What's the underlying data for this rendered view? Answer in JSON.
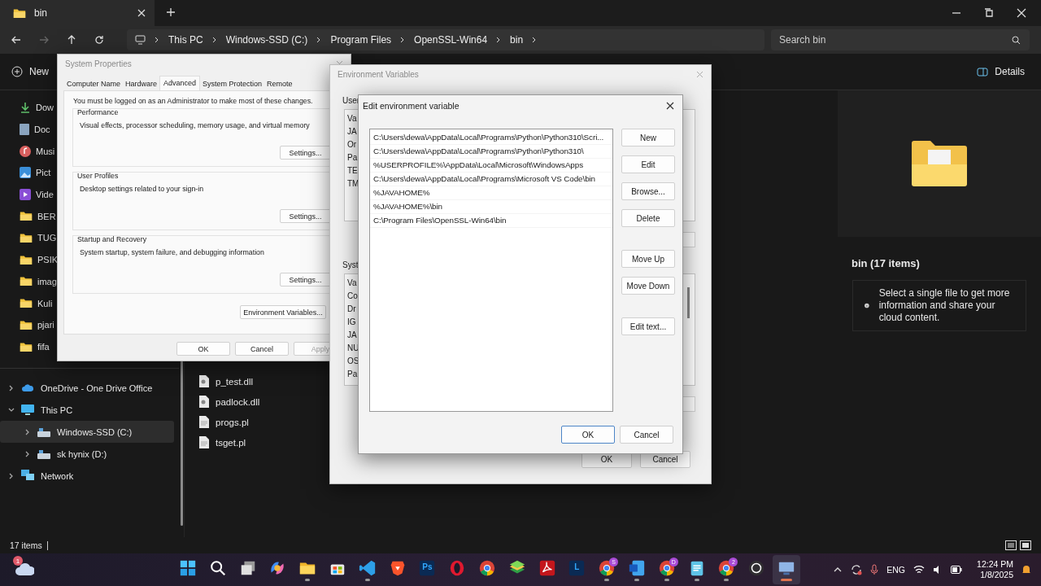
{
  "explorer": {
    "tab": {
      "title": "bin"
    },
    "breadcrumb": [
      "This PC",
      "Windows-SSD (C:)",
      "Program Files",
      "OpenSSL-Win64",
      "bin"
    ],
    "search": {
      "placeholder": "Search bin"
    },
    "toolbar": {
      "new": "New",
      "details": "Details"
    },
    "quick_access": [
      {
        "label": "Dow",
        "kind": "download"
      },
      {
        "label": "Doc",
        "kind": "document"
      },
      {
        "label": "Musi",
        "kind": "music"
      },
      {
        "label": "Pict",
        "kind": "picture"
      },
      {
        "label": "Vide",
        "kind": "video"
      },
      {
        "label": "BER",
        "kind": "folder"
      },
      {
        "label": "TUG",
        "kind": "folder"
      },
      {
        "label": "PSIK",
        "kind": "folder"
      },
      {
        "label": "imag",
        "kind": "folder"
      },
      {
        "label": "Kuli",
        "kind": "folder"
      },
      {
        "label": "pjari",
        "kind": "folder"
      },
      {
        "label": "fifa",
        "kind": "folder"
      }
    ],
    "tree": [
      {
        "label": "OneDrive - One Drive Office",
        "kind": "cloud",
        "expanded": false,
        "selected": false
      },
      {
        "label": "This PC",
        "kind": "pc",
        "expanded": true,
        "selected": false,
        "children": [
          {
            "label": "Windows-SSD (C:)",
            "kind": "drive",
            "expanded": false,
            "selected": true
          },
          {
            "label": "sk hynix (D:)",
            "kind": "drive",
            "expanded": false,
            "selected": false
          }
        ]
      },
      {
        "label": "Network",
        "kind": "network",
        "expanded": false,
        "selected": false
      }
    ],
    "files": [
      {
        "name": "p_test.dll",
        "kind": "dll"
      },
      {
        "name": "padlock.dll",
        "kind": "dll"
      },
      {
        "name": "progs.pl",
        "kind": "text"
      },
      {
        "name": "tsget.pl",
        "kind": "text"
      }
    ],
    "details": {
      "title": "bin (17 items)",
      "message": "Select a single file to get more information and share your cloud content."
    },
    "status_bar": {
      "count": "17 items"
    }
  },
  "system_properties": {
    "title": "System Properties",
    "tabs": [
      {
        "label": "Computer Name",
        "selected": false
      },
      {
        "label": "Hardware",
        "selected": false
      },
      {
        "label": "Advanced",
        "selected": true
      },
      {
        "label": "System Protection",
        "selected": false
      },
      {
        "label": "Remote",
        "selected": false
      }
    ],
    "note": "You must be logged on as an Administrator to make most of these changes.",
    "groups": [
      {
        "title": "Performance",
        "description": "Visual effects, processor scheduling, memory usage, and virtual memory",
        "button": "Settings..."
      },
      {
        "title": "User Profiles",
        "description": "Desktop settings related to your sign-in",
        "button": "Settings..."
      },
      {
        "title": "Startup and Recovery",
        "description": "System startup, system failure, and debugging information",
        "button": "Settings..."
      }
    ],
    "env_button": "Environment Variables...",
    "buttons": [
      {
        "label": "OK",
        "disabled": false
      },
      {
        "label": "Cancel",
        "disabled": false
      },
      {
        "label": "Apply",
        "disabled": true
      }
    ]
  },
  "environment_variables": {
    "title": "Environment Variables",
    "user_label": "User",
    "user_rows": [
      "Va",
      "JA",
      "Or",
      "Pa",
      "TE",
      "TM"
    ],
    "system_label": "Syst",
    "system_rows": [
      "Va",
      "Co",
      "Dr",
      "IG",
      "JA",
      "NU",
      "OS",
      "Pa"
    ],
    "buttons": [
      "OK",
      "Cancel"
    ]
  },
  "edit_dialog": {
    "title": "Edit environment variable",
    "entries": [
      "C:\\Users\\dewa\\AppData\\Local\\Programs\\Python\\Python310\\Scri...",
      "C:\\Users\\dewa\\AppData\\Local\\Programs\\Python\\Python310\\",
      "%USERPROFILE%\\AppData\\Local\\Microsoft\\WindowsApps",
      "C:\\Users\\dewa\\AppData\\Local\\Programs\\Microsoft VS Code\\bin",
      "%JAVAHOME%",
      "%JAVAHOME%\\bin",
      "C:\\Program Files\\OpenSSL-Win64\\bin"
    ],
    "button_groups": [
      [
        "New",
        "Edit",
        "Browse...",
        "Delete"
      ],
      [
        "Move Up",
        "Move Down"
      ],
      [
        "Edit text..."
      ]
    ],
    "footer": [
      {
        "label": "OK",
        "default": true
      },
      {
        "label": "Cancel",
        "default": false
      }
    ]
  },
  "taskbar": {
    "weather_badge": "1",
    "apps": [
      {
        "kind": "start",
        "running": false,
        "selected": false
      },
      {
        "kind": "search",
        "running": false,
        "selected": false
      },
      {
        "kind": "taskview",
        "running": false,
        "selected": false
      },
      {
        "kind": "copilot",
        "running": false,
        "selected": false
      },
      {
        "kind": "explorer",
        "running": true,
        "selected": false
      },
      {
        "kind": "store",
        "running": false,
        "selected": false
      },
      {
        "kind": "vscode",
        "running": true,
        "selected": false
      },
      {
        "kind": "brave",
        "running": false,
        "selected": false
      },
      {
        "kind": "tile",
        "glyph": "Ps",
        "running": false,
        "selected": false
      },
      {
        "kind": "opera",
        "running": false,
        "selected": false
      },
      {
        "kind": "chrome",
        "running": false,
        "selected": false
      },
      {
        "kind": "layers",
        "running": false,
        "selected": false
      },
      {
        "kind": "acrobat",
        "running": false,
        "selected": false
      },
      {
        "kind": "tile",
        "glyph": "L",
        "running": false,
        "selected": false
      },
      {
        "kind": "chrome",
        "badge": "S",
        "running": true,
        "selected": false
      },
      {
        "kind": "word",
        "running": true,
        "selected": false
      },
      {
        "kind": "chrome",
        "badge": "D",
        "running": true,
        "selected": false
      },
      {
        "kind": "notepad",
        "running": true,
        "selected": false
      },
      {
        "kind": "chrome",
        "badge": "2",
        "running": true,
        "selected": false
      },
      {
        "kind": "obs",
        "running": false,
        "selected": false
      },
      {
        "kind": "remote",
        "running": true,
        "selected": true
      }
    ],
    "language": "ENG",
    "time": "12:24 PM",
    "date": "1/8/2025"
  }
}
